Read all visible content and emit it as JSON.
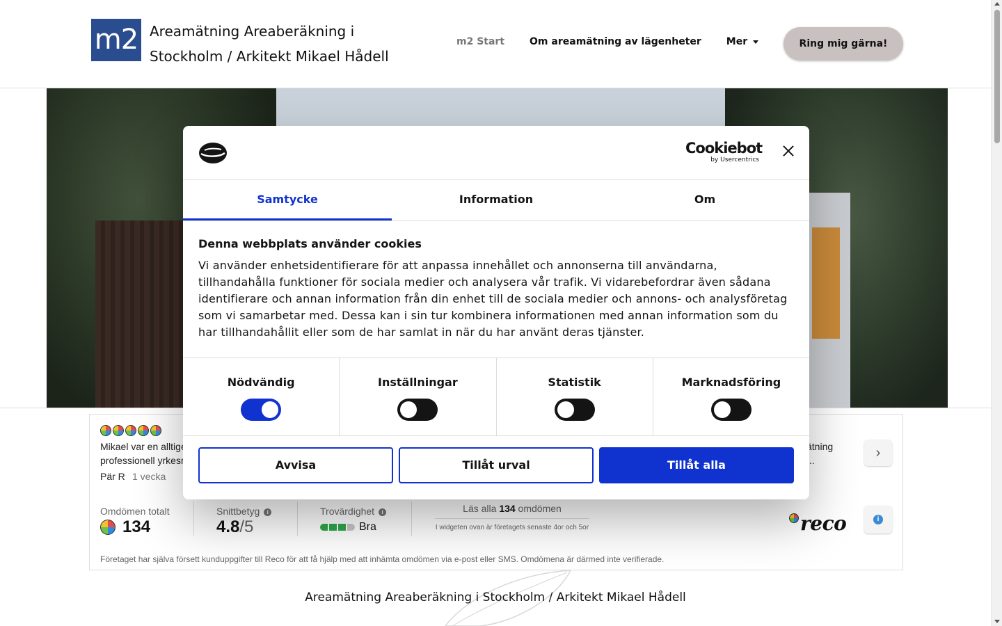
{
  "header": {
    "logo": "m2",
    "site_title": "Areamätning Areaberäkning i Stockholm / Arkitekt Mikael Hådell",
    "nav": [
      {
        "label": "m2 Start"
      },
      {
        "label": "Om areamätning av lägenheter"
      },
      {
        "label": "Mer"
      }
    ],
    "cta": "Ring mig gärna!"
  },
  "reviews": {
    "first": {
      "text_line1": "Mikael var en alltige",
      "text_line2": "professionell yrkesm",
      "author": "Pär R",
      "date": "1 vecka"
    },
    "second": {
      "text_line1": "ätning",
      "text_line2": "..."
    },
    "stats": {
      "total_label": "Omdömen totalt",
      "total_value": "134",
      "avg_label": "Snittbetyg",
      "avg_value": "4.8",
      "avg_max": "/5",
      "trust_label": "Trovärdighet",
      "trust_word": "Bra",
      "trust_level": 0.75,
      "read_prefix": "Läs alla ",
      "read_count": "134",
      "read_suffix": " omdömen",
      "read_sub": "I widgeten ovan är företagets senaste 4or och 5or"
    },
    "brand": "reco",
    "disclaimer": "Företaget har själva försett kunduppgifter till Reco för att få hjälp med att inhämta omdömen via e-post eller SMS. Omdömena är därmed inte verifierade."
  },
  "footer_title": "Areamätning Areaberäkning i Stockholm / Arkitekt Mikael Hådell",
  "cookie_dialog": {
    "brand_big": "Cookiebot",
    "brand_small": "by Usercentrics",
    "tabs": [
      "Samtycke",
      "Information",
      "Om"
    ],
    "title": "Denna webbplats använder cookies",
    "body": "Vi använder enhetsidentifierare för att anpassa innehållet och annonserna till användarna, tillhandahålla funktioner för sociala medier och analysera vår trafik. Vi vidarebefordrar även sådana identifierare och annan information från din enhet till de sociala medier och annons- och analysföretag som vi samarbetar med. Dessa kan i sin tur kombinera informationen med annan information som du har tillhandahållit eller som de har samlat in när du har använt deras tjänster.",
    "categories": [
      {
        "label": "Nödvändig",
        "on": true
      },
      {
        "label": "Inställningar",
        "on": false
      },
      {
        "label": "Statistik",
        "on": false
      },
      {
        "label": "Marknadsföring",
        "on": false
      }
    ],
    "buttons": {
      "deny": "Avvisa",
      "allow_selection": "Tillåt urval",
      "allow_all": "Tillåt alla"
    }
  },
  "colors": {
    "accent": "#1032cf",
    "logo_bg": "#2a4d8f",
    "cta_bg": "#c9c1c0",
    "trust_green": "#2ea84a"
  }
}
